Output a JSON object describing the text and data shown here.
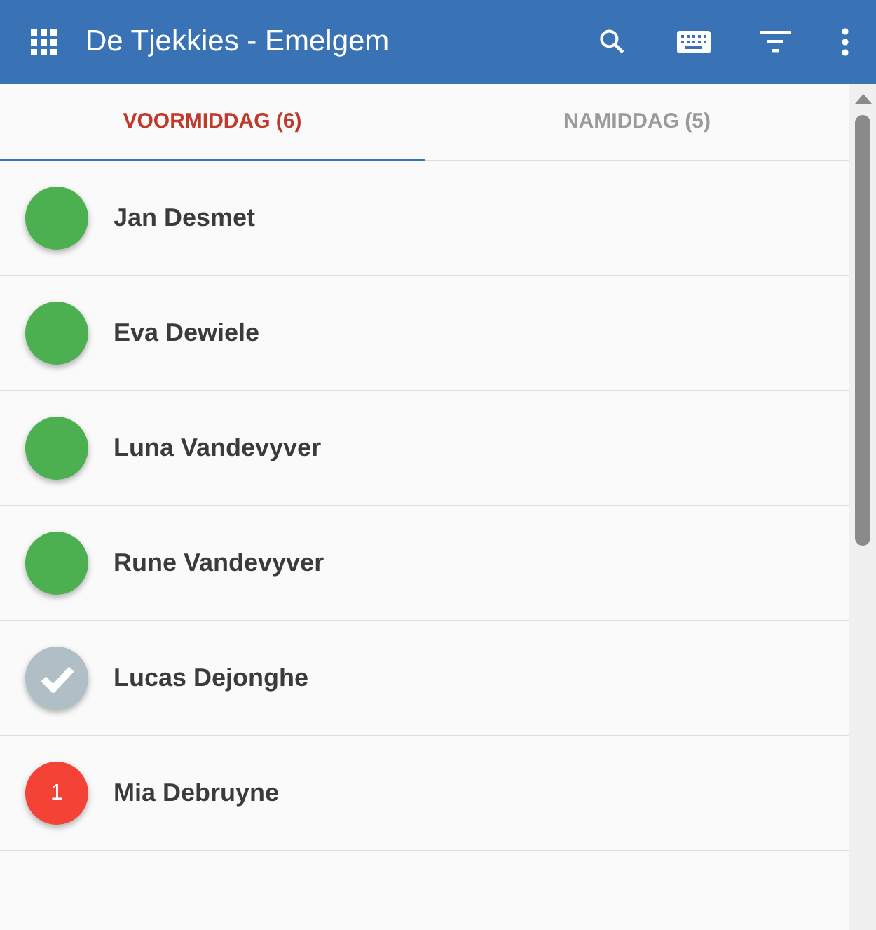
{
  "app_bar": {
    "title": "De Tjekkies - Emelgem"
  },
  "tabs": [
    {
      "label": "VOORMIDDAG (6)",
      "selected": true
    },
    {
      "label": "NAMIDDAG (5)",
      "selected": false
    }
  ],
  "children": [
    {
      "name": "Jan Desmet",
      "kind": "present"
    },
    {
      "name": "Eva Dewiele",
      "kind": "present"
    },
    {
      "name": "Luna Vandevyver",
      "kind": "present"
    },
    {
      "name": "Rune Vandevyver",
      "kind": "present"
    },
    {
      "name": "Lucas Dejonghe",
      "kind": "checked"
    },
    {
      "name": "Mia Debruyne",
      "kind": "alert",
      "count": "1"
    }
  ]
}
